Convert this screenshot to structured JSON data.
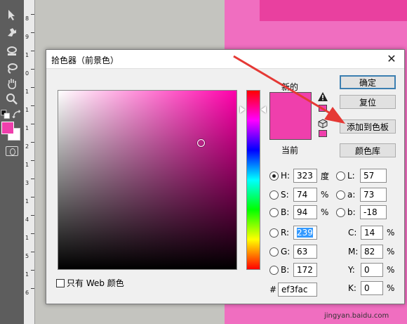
{
  "dialog": {
    "title": "拾色器（前景色）",
    "close_glyph": "✕",
    "label_new": "新的",
    "label_current": "当前",
    "buttons": {
      "ok": "确定",
      "reset": "复位",
      "add_to_swatches": "添加到色板",
      "color_libraries": "颜色库"
    },
    "hsb": {
      "h": {
        "label": "H:",
        "value": "323",
        "unit": "度"
      },
      "s": {
        "label": "S:",
        "value": "74",
        "unit": "%"
      },
      "b": {
        "label": "B:",
        "value": "94",
        "unit": "%"
      }
    },
    "rgb": {
      "r": {
        "label": "R:",
        "value": "239"
      },
      "g": {
        "label": "G:",
        "value": "63"
      },
      "b": {
        "label": "B:",
        "value": "172"
      }
    },
    "lab": {
      "l": {
        "label": "L:",
        "value": "57"
      },
      "a": {
        "label": "a:",
        "value": "73"
      },
      "b": {
        "label": "b:",
        "value": "-18"
      }
    },
    "cmyk": {
      "c": {
        "label": "C:",
        "value": "14",
        "unit": "%"
      },
      "m": {
        "label": "M:",
        "value": "82",
        "unit": "%"
      },
      "y": {
        "label": "Y:",
        "value": "0",
        "unit": "%"
      },
      "k": {
        "label": "K:",
        "value": "0",
        "unit": "%"
      }
    },
    "hex": {
      "label": "#",
      "value": "ef3fac"
    },
    "web_only": "只有 Web 颜色"
  },
  "ruler": [
    "8",
    "9",
    "1",
    "0",
    "1",
    "1",
    "1",
    "2",
    "1",
    "3",
    "1",
    "4",
    "1",
    "5",
    "1",
    "6"
  ],
  "colors": {
    "selected": "#ef3fac",
    "accent": "#3c7fb1",
    "annotation_arrow": "#e53935"
  },
  "watermark": "jingyan.baidu.com"
}
